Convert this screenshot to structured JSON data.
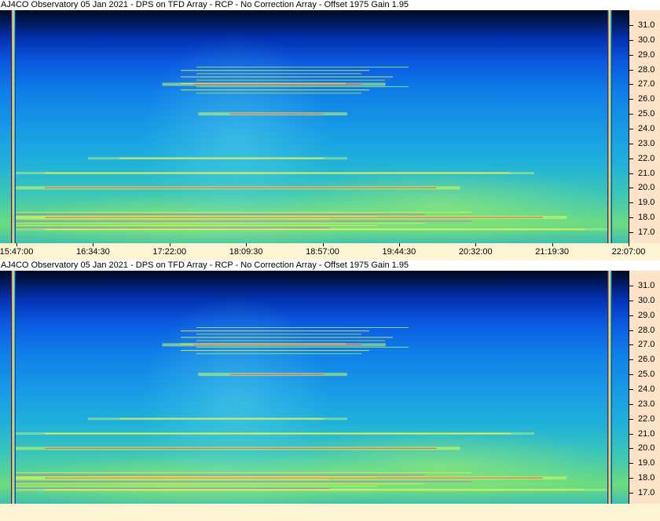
{
  "panels": [
    {
      "title": "AJ4CO Observatory 05 Jan 2021 - DPS on TFD Array  - RCP  -  No Correction Array  -  Offset 1975  Gain 1.95",
      "y_labels": [
        "31.0",
        "30.0",
        "29.0",
        "28.0",
        "27.0",
        "26.0",
        "25.0",
        "24.0",
        "23.0",
        "22.0",
        "21.0",
        "20.0",
        "19.0",
        "18.0",
        "17.0"
      ],
      "x_labels": [
        "15:47:00",
        "16:34:30",
        "17:22:00",
        "18:09:30",
        "18:57:00",
        "19:44:30",
        "20:32:00",
        "21:19:30",
        "22:07:00"
      ]
    },
    {
      "title": "AJ4CO Observatory 05 Jan 2021 - DPS on TFD Array  - RCP  -  No Correction Array  -  Offset 1975  Gain 1.95",
      "y_labels": [
        "31.0",
        "30.0",
        "29.0",
        "28.0",
        "27.0",
        "26.0",
        "25.0",
        "24.0",
        "23.0",
        "22.0",
        "21.0",
        "20.0",
        "19.0",
        "18.0",
        "17.0"
      ],
      "x_labels": []
    }
  ],
  "chart_data": {
    "type": "heatmap",
    "ylim": [
      16.5,
      31.5
    ],
    "x_range": [
      "15:47:00",
      "22:07:00"
    ],
    "colormap": [
      "#000b22",
      "#0330b0",
      "#0f7ee8",
      "#1eb0dc",
      "#6cdc7e",
      "#ffff40",
      "#ff3030"
    ],
    "emission_bands_mhz": [
      {
        "freq": 27.0,
        "t_start": "17:22:00",
        "t_end": "19:44:30",
        "intensity": "high"
      },
      {
        "freq": 25.0,
        "t_start": "17:45:00",
        "t_end": "19:20:00",
        "intensity": "high"
      },
      {
        "freq": 22.0,
        "t_start": "16:34:30",
        "t_end": "19:20:00",
        "intensity": "medium"
      },
      {
        "freq": 21.0,
        "t_start": "15:47:00",
        "t_end": "21:19:30",
        "intensity": "medium"
      },
      {
        "freq": 20.0,
        "t_start": "15:47:00",
        "t_end": "20:32:00",
        "intensity": "high"
      },
      {
        "freq": 18.0,
        "t_start": "15:47:00",
        "t_end": "21:40:00",
        "intensity": "high"
      },
      {
        "freq": 17.2,
        "t_start": "15:47:00",
        "t_end": "22:07:00",
        "intensity": "medium"
      }
    ],
    "colors": {
      "vertical_marker_1": "#8a5a5a",
      "vertical_marker_2": "#8a5a5a"
    }
  }
}
